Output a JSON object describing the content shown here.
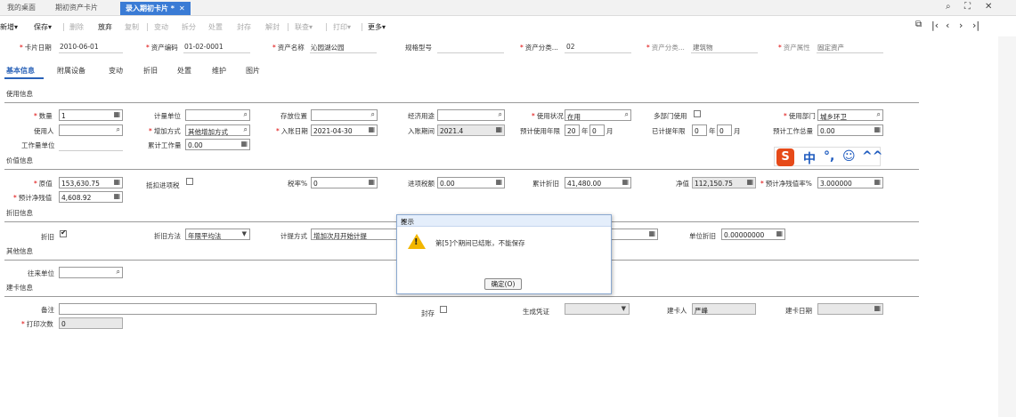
{
  "tabs": [
    "我的桌面",
    "期初资产卡片",
    "录入期初卡片 *"
  ],
  "toolbar": {
    "new": "新增▾",
    "save": "保存▾",
    "delete": "删除",
    "discard": "放弃",
    "copy": "复制",
    "change": "变动",
    "split": "拆分",
    "dispose": "处置",
    "seal": "封存",
    "unseal": "解封",
    "query": "联查▾",
    "print": "打印▾",
    "more": "更多▾"
  },
  "header": {
    "card_date_label": "卡片日期",
    "card_date": "2010-06-01",
    "asset_code_label": "资产编码",
    "asset_code": "01-02-0001",
    "asset_name_label": "资产名称",
    "asset_name": "沁园湖公园",
    "spec_label": "规格型号",
    "category1_label": "资产分类...",
    "category1": "02",
    "category2_label": "资产分类...",
    "category2": "建筑物",
    "attr_label": "资产属性",
    "attr": "固定资产"
  },
  "subtabs": [
    "基本信息",
    "附属设备",
    "变动",
    "折旧",
    "处置",
    "维护",
    "图片"
  ],
  "sections": {
    "usage": "使用信息",
    "value": "价值信息",
    "depr": "折旧信息",
    "other": "其他信息",
    "build": "建卡信息"
  },
  "usage": {
    "qty_label": "数量",
    "qty": "1",
    "unit_label": "计量单位",
    "location_label": "存放位置",
    "econ_label": "经济用途",
    "status_label": "使用状况",
    "status": "在用",
    "multidept_label": "多部门使用",
    "dept_label": "使用部门",
    "dept": "城乡环卫",
    "user_label": "使用人",
    "add_method_label": "增加方式",
    "add_method": "其他增加方式",
    "entry_date_label": "入账日期",
    "entry_date": "2021-04-30",
    "entry_period_label": "入账期间",
    "entry_period": "2021.4",
    "expected_life_label": "预计使用年限",
    "life_years": "20",
    "life_months": "0",
    "year_unit": "年",
    "month_unit": "月",
    "used_life_label": "已计提年限",
    "used_years": "0",
    "used_months": "0",
    "expected_work_label": "预计工作总量",
    "expected_work": "0.00",
    "workload_unit_label": "工作量单位",
    "cum_work_label": "累计工作量",
    "cum_work": "0.00"
  },
  "value": {
    "orig_label": "原值",
    "orig": "153,630.75",
    "deduct_label": "抵扣进项税",
    "tax_rate_label": "税率%",
    "tax_rate": "0",
    "input_tax_label": "进项税额",
    "input_tax": "0.00",
    "cum_depr_label": "累计折旧",
    "cum_depr": "41,480.00",
    "net_label": "净值",
    "net": "112,150.75",
    "salvage_rate_label": "预计净残值率%",
    "salvage_rate": "3.000000",
    "salvage_label": "预计净残值",
    "salvage": "4,608.92"
  },
  "depr": {
    "depr_label": "折旧",
    "method_label": "折旧方法",
    "method": "年限平均法",
    "accrual_label": "计提方式",
    "accrual": "增加次月开始计提",
    "unit_depr_label": "单位折旧",
    "unit_depr": "0.00000000"
  },
  "other": {
    "partner_label": "往来单位"
  },
  "build": {
    "remark_label": "备注",
    "sealed_label": "封存",
    "voucher_label": "生成凭证",
    "creator_label": "建卡人",
    "creator": "严峰",
    "create_date_label": "建卡日期",
    "print_count_label": "打印次数",
    "print_count": "0"
  },
  "dialog": {
    "title": "提示",
    "message": "第[5]个期间已结账，不能保存",
    "ok": "确定(O)"
  },
  "ime": {
    "cn": "中",
    "punct": "°,",
    "emoji": "☺",
    "skin": "^^"
  }
}
